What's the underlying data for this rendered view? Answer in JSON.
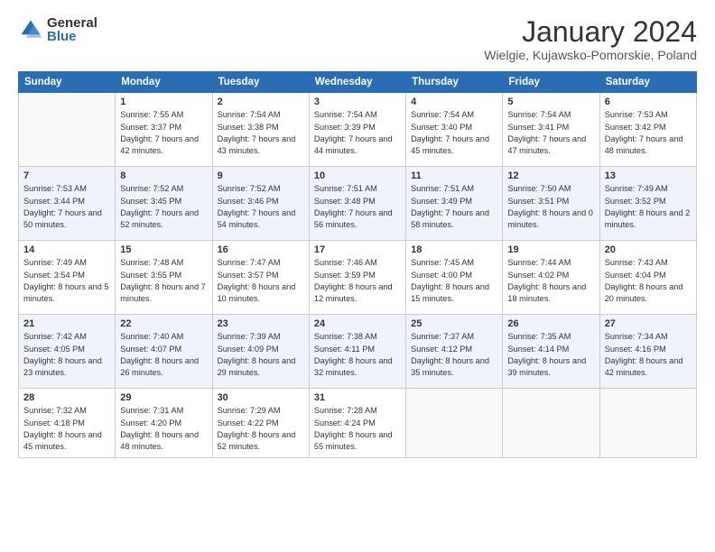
{
  "logo": {
    "general": "General",
    "blue": "Blue"
  },
  "header": {
    "month": "January 2024",
    "location": "Wielgie, Kujawsko-Pomorskie, Poland"
  },
  "weekdays": [
    "Sunday",
    "Monday",
    "Tuesday",
    "Wednesday",
    "Thursday",
    "Friday",
    "Saturday"
  ],
  "weeks": [
    [
      {
        "day": "",
        "sunrise": "",
        "sunset": "",
        "daylight": ""
      },
      {
        "day": "1",
        "sunrise": "Sunrise: 7:55 AM",
        "sunset": "Sunset: 3:37 PM",
        "daylight": "Daylight: 7 hours and 42 minutes."
      },
      {
        "day": "2",
        "sunrise": "Sunrise: 7:54 AM",
        "sunset": "Sunset: 3:38 PM",
        "daylight": "Daylight: 7 hours and 43 minutes."
      },
      {
        "day": "3",
        "sunrise": "Sunrise: 7:54 AM",
        "sunset": "Sunset: 3:39 PM",
        "daylight": "Daylight: 7 hours and 44 minutes."
      },
      {
        "day": "4",
        "sunrise": "Sunrise: 7:54 AM",
        "sunset": "Sunset: 3:40 PM",
        "daylight": "Daylight: 7 hours and 45 minutes."
      },
      {
        "day": "5",
        "sunrise": "Sunrise: 7:54 AM",
        "sunset": "Sunset: 3:41 PM",
        "daylight": "Daylight: 7 hours and 47 minutes."
      },
      {
        "day": "6",
        "sunrise": "Sunrise: 7:53 AM",
        "sunset": "Sunset: 3:42 PM",
        "daylight": "Daylight: 7 hours and 48 minutes."
      }
    ],
    [
      {
        "day": "7",
        "sunrise": "Sunrise: 7:53 AM",
        "sunset": "Sunset: 3:44 PM",
        "daylight": "Daylight: 7 hours and 50 minutes."
      },
      {
        "day": "8",
        "sunrise": "Sunrise: 7:52 AM",
        "sunset": "Sunset: 3:45 PM",
        "daylight": "Daylight: 7 hours and 52 minutes."
      },
      {
        "day": "9",
        "sunrise": "Sunrise: 7:52 AM",
        "sunset": "Sunset: 3:46 PM",
        "daylight": "Daylight: 7 hours and 54 minutes."
      },
      {
        "day": "10",
        "sunrise": "Sunrise: 7:51 AM",
        "sunset": "Sunset: 3:48 PM",
        "daylight": "Daylight: 7 hours and 56 minutes."
      },
      {
        "day": "11",
        "sunrise": "Sunrise: 7:51 AM",
        "sunset": "Sunset: 3:49 PM",
        "daylight": "Daylight: 7 hours and 58 minutes."
      },
      {
        "day": "12",
        "sunrise": "Sunrise: 7:50 AM",
        "sunset": "Sunset: 3:51 PM",
        "daylight": "Daylight: 8 hours and 0 minutes."
      },
      {
        "day": "13",
        "sunrise": "Sunrise: 7:49 AM",
        "sunset": "Sunset: 3:52 PM",
        "daylight": "Daylight: 8 hours and 2 minutes."
      }
    ],
    [
      {
        "day": "14",
        "sunrise": "Sunrise: 7:49 AM",
        "sunset": "Sunset: 3:54 PM",
        "daylight": "Daylight: 8 hours and 5 minutes."
      },
      {
        "day": "15",
        "sunrise": "Sunrise: 7:48 AM",
        "sunset": "Sunset: 3:55 PM",
        "daylight": "Daylight: 8 hours and 7 minutes."
      },
      {
        "day": "16",
        "sunrise": "Sunrise: 7:47 AM",
        "sunset": "Sunset: 3:57 PM",
        "daylight": "Daylight: 8 hours and 10 minutes."
      },
      {
        "day": "17",
        "sunrise": "Sunrise: 7:46 AM",
        "sunset": "Sunset: 3:59 PM",
        "daylight": "Daylight: 8 hours and 12 minutes."
      },
      {
        "day": "18",
        "sunrise": "Sunrise: 7:45 AM",
        "sunset": "Sunset: 4:00 PM",
        "daylight": "Daylight: 8 hours and 15 minutes."
      },
      {
        "day": "19",
        "sunrise": "Sunrise: 7:44 AM",
        "sunset": "Sunset: 4:02 PM",
        "daylight": "Daylight: 8 hours and 18 minutes."
      },
      {
        "day": "20",
        "sunrise": "Sunrise: 7:43 AM",
        "sunset": "Sunset: 4:04 PM",
        "daylight": "Daylight: 8 hours and 20 minutes."
      }
    ],
    [
      {
        "day": "21",
        "sunrise": "Sunrise: 7:42 AM",
        "sunset": "Sunset: 4:05 PM",
        "daylight": "Daylight: 8 hours and 23 minutes."
      },
      {
        "day": "22",
        "sunrise": "Sunrise: 7:40 AM",
        "sunset": "Sunset: 4:07 PM",
        "daylight": "Daylight: 8 hours and 26 minutes."
      },
      {
        "day": "23",
        "sunrise": "Sunrise: 7:39 AM",
        "sunset": "Sunset: 4:09 PM",
        "daylight": "Daylight: 8 hours and 29 minutes."
      },
      {
        "day": "24",
        "sunrise": "Sunrise: 7:38 AM",
        "sunset": "Sunset: 4:11 PM",
        "daylight": "Daylight: 8 hours and 32 minutes."
      },
      {
        "day": "25",
        "sunrise": "Sunrise: 7:37 AM",
        "sunset": "Sunset: 4:12 PM",
        "daylight": "Daylight: 8 hours and 35 minutes."
      },
      {
        "day": "26",
        "sunrise": "Sunrise: 7:35 AM",
        "sunset": "Sunset: 4:14 PM",
        "daylight": "Daylight: 8 hours and 39 minutes."
      },
      {
        "day": "27",
        "sunrise": "Sunrise: 7:34 AM",
        "sunset": "Sunset: 4:16 PM",
        "daylight": "Daylight: 8 hours and 42 minutes."
      }
    ],
    [
      {
        "day": "28",
        "sunrise": "Sunrise: 7:32 AM",
        "sunset": "Sunset: 4:18 PM",
        "daylight": "Daylight: 8 hours and 45 minutes."
      },
      {
        "day": "29",
        "sunrise": "Sunrise: 7:31 AM",
        "sunset": "Sunset: 4:20 PM",
        "daylight": "Daylight: 8 hours and 48 minutes."
      },
      {
        "day": "30",
        "sunrise": "Sunrise: 7:29 AM",
        "sunset": "Sunset: 4:22 PM",
        "daylight": "Daylight: 8 hours and 52 minutes."
      },
      {
        "day": "31",
        "sunrise": "Sunrise: 7:28 AM",
        "sunset": "Sunset: 4:24 PM",
        "daylight": "Daylight: 8 hours and 55 minutes."
      },
      {
        "day": "",
        "sunrise": "",
        "sunset": "",
        "daylight": ""
      },
      {
        "day": "",
        "sunrise": "",
        "sunset": "",
        "daylight": ""
      },
      {
        "day": "",
        "sunrise": "",
        "sunset": "",
        "daylight": ""
      }
    ]
  ]
}
